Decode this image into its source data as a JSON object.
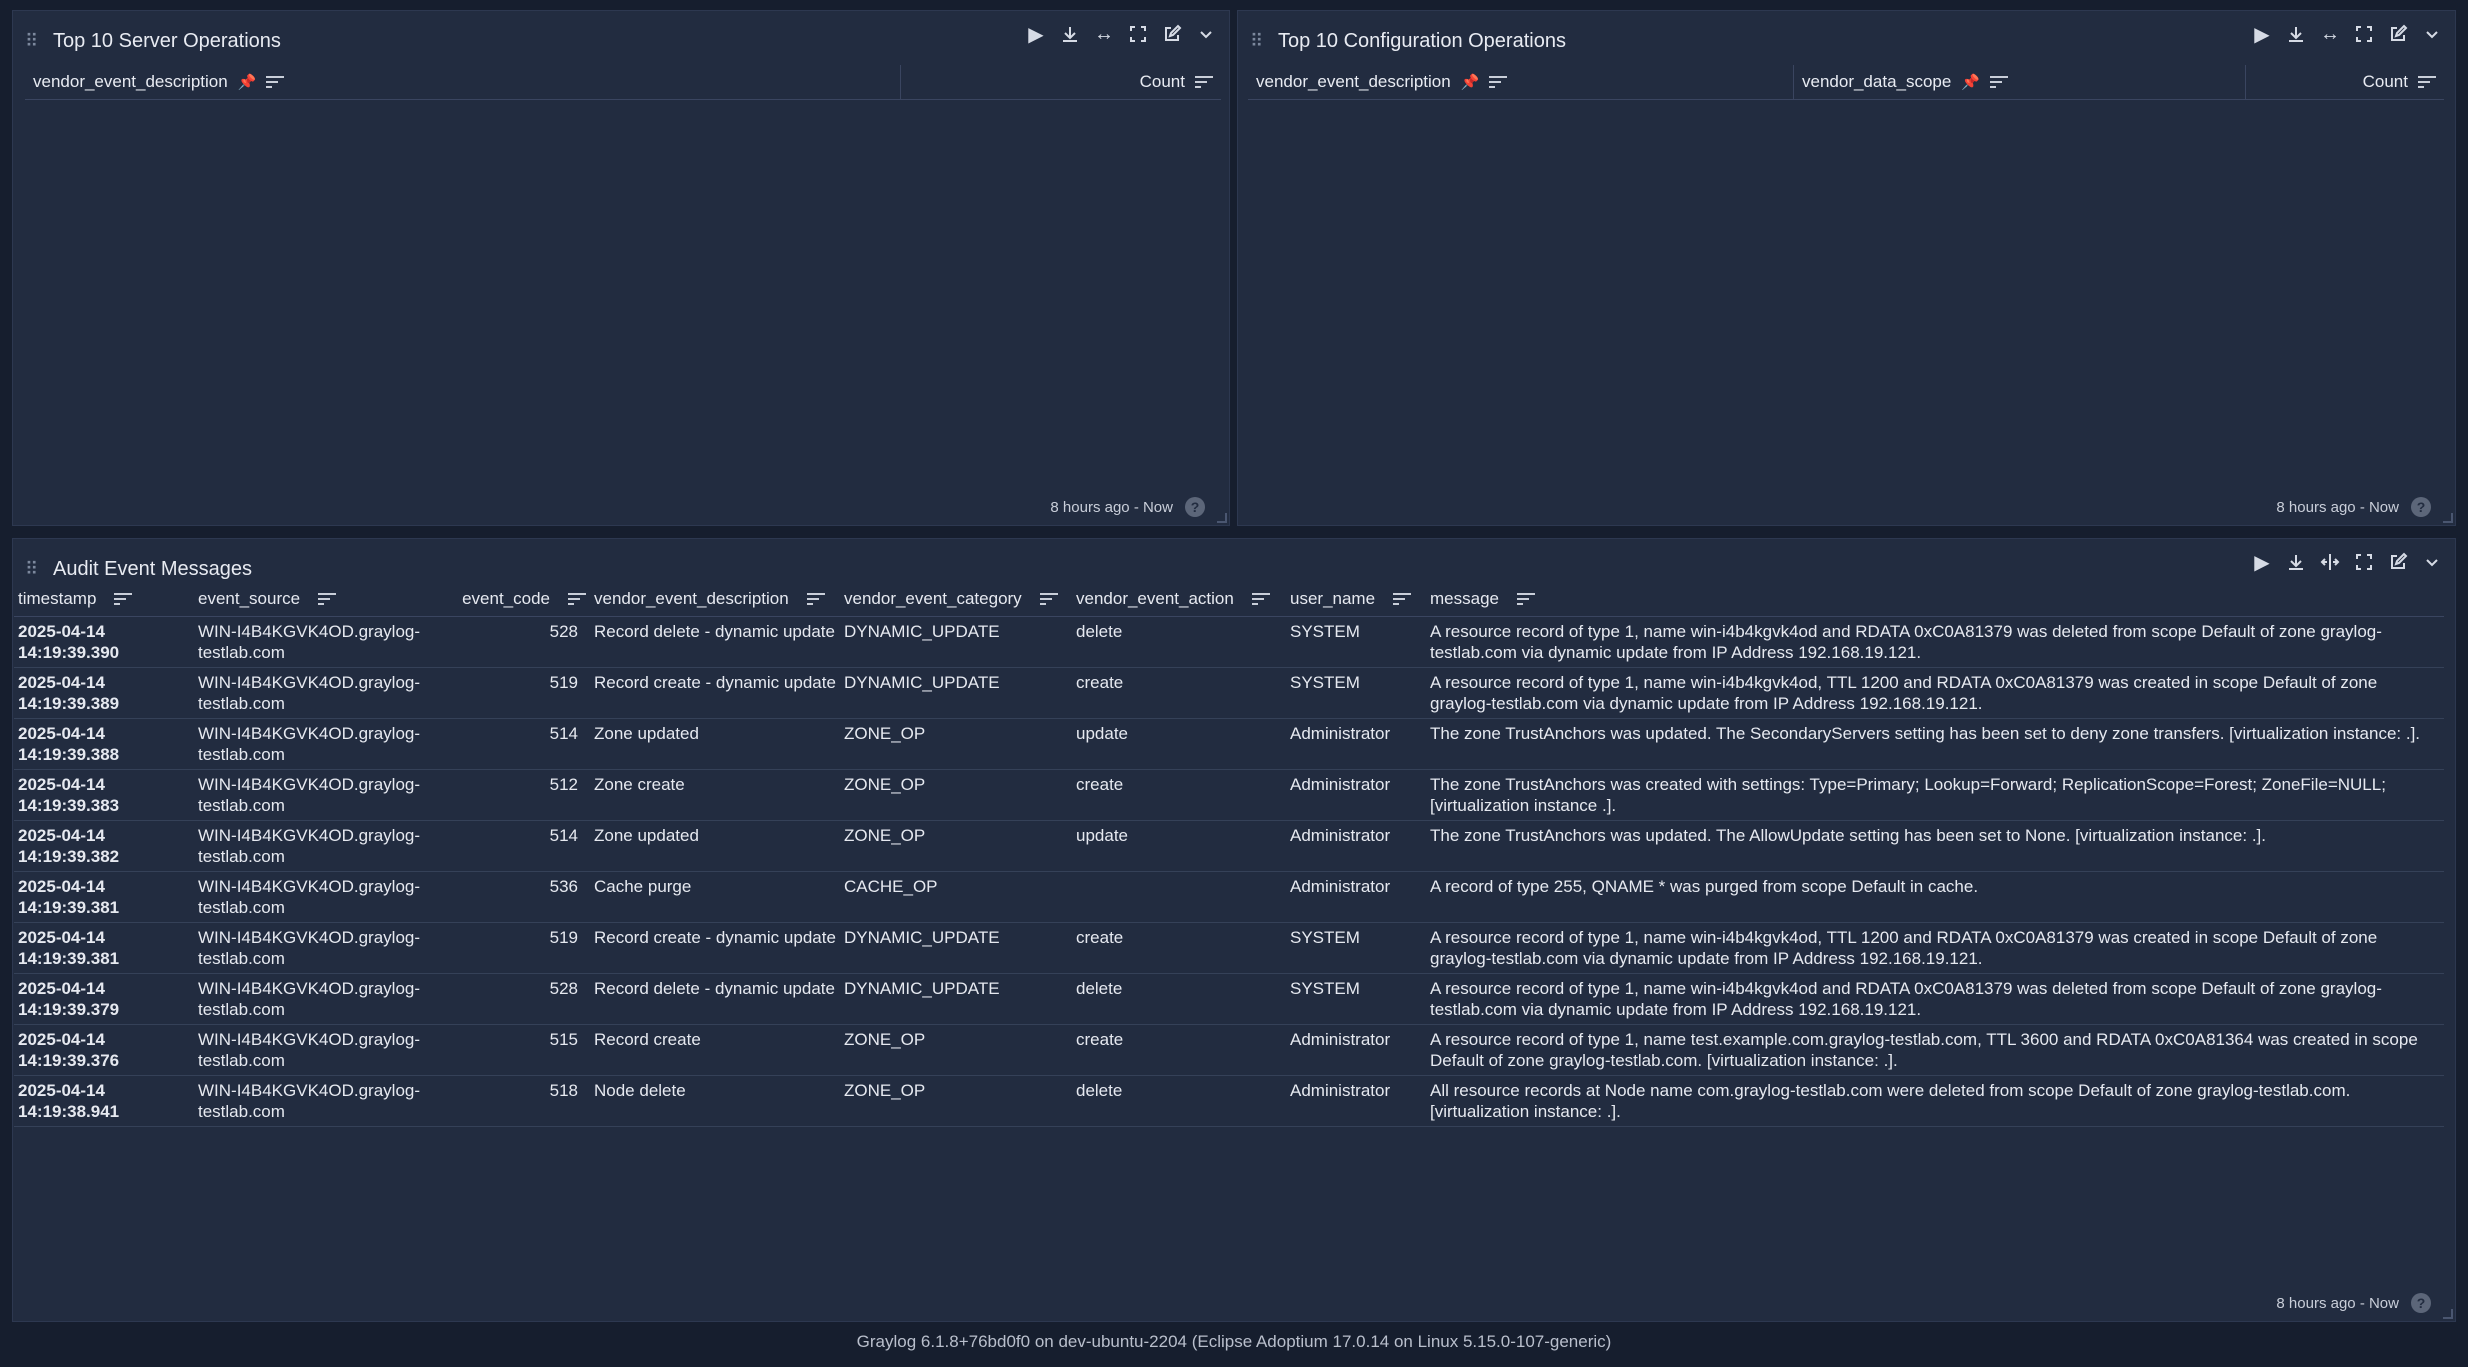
{
  "widgets": {
    "server_ops": {
      "title": "Top 10 Server Operations",
      "col1": "vendor_event_description",
      "col2": "Count",
      "timerange": "8 hours ago - Now"
    },
    "config_ops": {
      "title": "Top 10 Configuration Operations",
      "col1": "vendor_event_description",
      "col2": "vendor_data_scope",
      "col3": "Count",
      "timerange": "8 hours ago - Now"
    },
    "audit": {
      "title": "Audit Event Messages",
      "timerange": "8 hours ago - Now",
      "columns": [
        "timestamp",
        "event_source",
        "event_code",
        "vendor_event_description",
        "vendor_event_category",
        "vendor_event_action",
        "user_name",
        "message"
      ],
      "rows": [
        {
          "date": "2025-04-14",
          "time": "14:19:39.390",
          "source1": "WIN-I4B4KGVK4OD.graylog-",
          "source2": "testlab.com",
          "code": "528",
          "desc": "Record delete - dynamic update",
          "category": "DYNAMIC_UPDATE",
          "action": "delete",
          "user": "SYSTEM",
          "message": "A resource record of type 1, name win-i4b4kgvk4od and RDATA 0xC0A81379 was deleted from scope Default of zone graylog-testlab.com via dynamic update from IP Address 192.168.19.121."
        },
        {
          "date": "2025-04-14",
          "time": "14:19:39.389",
          "source1": "WIN-I4B4KGVK4OD.graylog-",
          "source2": "testlab.com",
          "code": "519",
          "desc": "Record create - dynamic update",
          "category": "DYNAMIC_UPDATE",
          "action": "create",
          "user": "SYSTEM",
          "message": "A resource record of type 1, name win-i4b4kgvk4od, TTL 1200 and RDATA 0xC0A81379 was created in scope Default of zone graylog-testlab.com via dynamic update from IP Address 192.168.19.121."
        },
        {
          "date": "2025-04-14",
          "time": "14:19:39.388",
          "source1": "WIN-I4B4KGVK4OD.graylog-",
          "source2": "testlab.com",
          "code": "514",
          "desc": "Zone updated",
          "category": "ZONE_OP",
          "action": "update",
          "user": "Administrator",
          "message": "The zone TrustAnchors was updated. The SecondaryServers setting has been set to deny zone transfers. [virtualization instance: .]."
        },
        {
          "date": "2025-04-14",
          "time": "14:19:39.383",
          "source1": "WIN-I4B4KGVK4OD.graylog-",
          "source2": "testlab.com",
          "code": "512",
          "desc": "Zone create",
          "category": "ZONE_OP",
          "action": "create",
          "user": "Administrator",
          "message": "The zone TrustAnchors was created with settings: Type=Primary; Lookup=Forward; ReplicationScope=Forest; ZoneFile=NULL; [virtualization instance .]."
        },
        {
          "date": "2025-04-14",
          "time": "14:19:39.382",
          "source1": "WIN-I4B4KGVK4OD.graylog-",
          "source2": "testlab.com",
          "code": "514",
          "desc": "Zone updated",
          "category": "ZONE_OP",
          "action": "update",
          "user": "Administrator",
          "message": "The zone TrustAnchors was updated. The AllowUpdate setting has been set to None. [virtualization instance: .]."
        },
        {
          "date": "2025-04-14",
          "time": "14:19:39.381",
          "source1": "WIN-I4B4KGVK4OD.graylog-",
          "source2": "testlab.com",
          "code": "536",
          "desc": "Cache purge",
          "category": "CACHE_OP",
          "action": "",
          "user": "Administrator",
          "message": "A record of type 255, QNAME * was purged from scope Default in cache."
        },
        {
          "date": "2025-04-14",
          "time": "14:19:39.381",
          "source1": "WIN-I4B4KGVK4OD.graylog-",
          "source2": "testlab.com",
          "code": "519",
          "desc": "Record create - dynamic update",
          "category": "DYNAMIC_UPDATE",
          "action": "create",
          "user": "SYSTEM",
          "message": "A resource record of type 1, name win-i4b4kgvk4od, TTL 1200 and RDATA 0xC0A81379 was created in scope Default of zone graylog-testlab.com via dynamic update from IP Address 192.168.19.121."
        },
        {
          "date": "2025-04-14",
          "time": "14:19:39.379",
          "source1": "WIN-I4B4KGVK4OD.graylog-",
          "source2": "testlab.com",
          "code": "528",
          "desc": "Record delete - dynamic update",
          "category": "DYNAMIC_UPDATE",
          "action": "delete",
          "user": "SYSTEM",
          "message": "A resource record of type 1, name win-i4b4kgvk4od and RDATA 0xC0A81379 was deleted from scope Default of zone graylog-testlab.com via dynamic update from IP Address 192.168.19.121."
        },
        {
          "date": "2025-04-14",
          "time": "14:19:39.376",
          "source1": "WIN-I4B4KGVK4OD.graylog-",
          "source2": "testlab.com",
          "code": "515",
          "desc": "Record create",
          "category": "ZONE_OP",
          "action": "create",
          "user": "Administrator",
          "message": "A resource record of type 1, name test.example.com.graylog-testlab.com, TTL 3600 and RDATA 0xC0A81364 was created in scope Default of zone graylog-testlab.com. [virtualization instance: .]."
        },
        {
          "date": "2025-04-14",
          "time": "14:19:38.941",
          "source1": "WIN-I4B4KGVK4OD.graylog-",
          "source2": "testlab.com",
          "code": "518",
          "desc": "Node delete",
          "category": "ZONE_OP",
          "action": "delete",
          "user": "Administrator",
          "message": "All resource records at Node name com.graylog-testlab.com were deleted from scope Default of zone graylog-testlab.com. [virtualization instance: .]."
        }
      ]
    }
  },
  "footer": "Graylog 6.1.8+76bd0f0 on dev-ubuntu-2204 (Eclipse Adoptium 17.0.14 on Linux 5.15.0-107-generic)",
  "colors": {
    "background": "#161e2e",
    "panel": "#222c40",
    "border": "#3a4560"
  }
}
